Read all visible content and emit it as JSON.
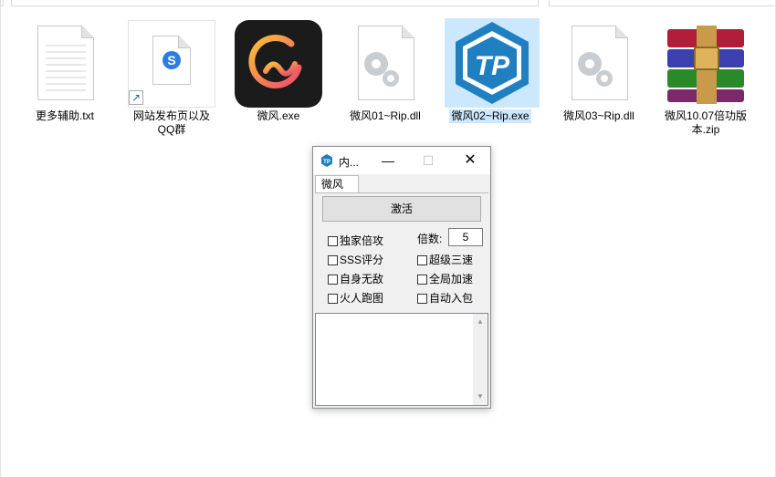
{
  "files": [
    {
      "name": "更多辅助.txt",
      "icon": "text-file-icon"
    },
    {
      "name": "网站发布页以及QQ群",
      "icon": "sogou-shortcut-icon"
    },
    {
      "name": "微风.exe",
      "icon": "weifeng-app-icon"
    },
    {
      "name": "微风01~Rip.dll",
      "icon": "dll-gear-icon"
    },
    {
      "name": "微风02~Rip.exe",
      "icon": "tp-hexagon-icon",
      "selected": true
    },
    {
      "name": "微风03~Rip.dll",
      "icon": "dll-gear-icon"
    },
    {
      "name": "微风10.07倍功版本.zip",
      "icon": "winrar-archive-icon"
    }
  ],
  "dialog": {
    "title": "内...",
    "minimize": "—",
    "maximize": "☐",
    "close": "✕",
    "tab": "微风",
    "activate_label": "激活",
    "multiplier_label": "倍数:",
    "multiplier_value": "5",
    "checkboxes_left": [
      "独家倍攻",
      "SSS评分",
      "自身无敌",
      "火人跑图"
    ],
    "checkboxes_right": [
      "超级三速",
      "全局加速",
      "自动入包"
    ],
    "log_text": ""
  },
  "colors": {
    "selection": "#cce8ff",
    "tp_blue": "#1f7fc0",
    "app_gradient_start": "#f5b23a",
    "app_gradient_end": "#ee4d6a"
  }
}
